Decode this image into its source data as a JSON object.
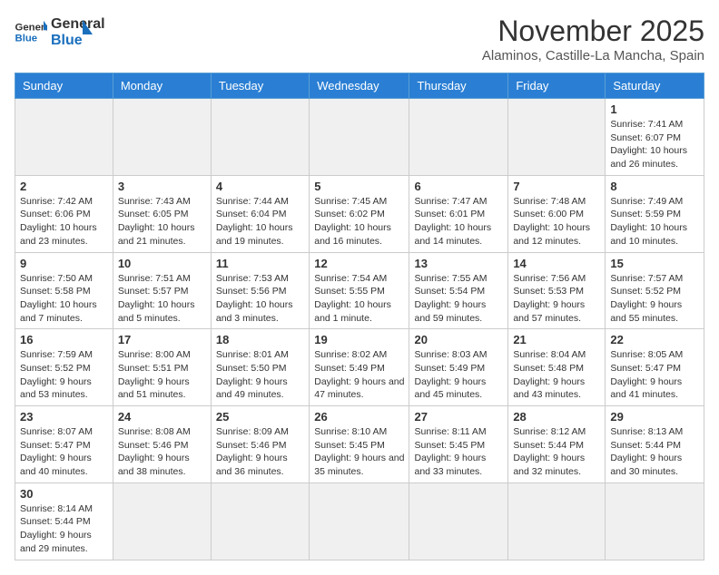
{
  "header": {
    "logo_general": "General",
    "logo_blue": "Blue",
    "month_title": "November 2025",
    "location": "Alaminos, Castille-La Mancha, Spain"
  },
  "weekdays": [
    "Sunday",
    "Monday",
    "Tuesday",
    "Wednesday",
    "Thursday",
    "Friday",
    "Saturday"
  ],
  "weeks": [
    [
      {
        "day": "",
        "info": ""
      },
      {
        "day": "",
        "info": ""
      },
      {
        "day": "",
        "info": ""
      },
      {
        "day": "",
        "info": ""
      },
      {
        "day": "",
        "info": ""
      },
      {
        "day": "",
        "info": ""
      },
      {
        "day": "1",
        "info": "Sunrise: 7:41 AM\nSunset: 6:07 PM\nDaylight: 10 hours and 26 minutes."
      }
    ],
    [
      {
        "day": "2",
        "info": "Sunrise: 7:42 AM\nSunset: 6:06 PM\nDaylight: 10 hours and 23 minutes."
      },
      {
        "day": "3",
        "info": "Sunrise: 7:43 AM\nSunset: 6:05 PM\nDaylight: 10 hours and 21 minutes."
      },
      {
        "day": "4",
        "info": "Sunrise: 7:44 AM\nSunset: 6:04 PM\nDaylight: 10 hours and 19 minutes."
      },
      {
        "day": "5",
        "info": "Sunrise: 7:45 AM\nSunset: 6:02 PM\nDaylight: 10 hours and 16 minutes."
      },
      {
        "day": "6",
        "info": "Sunrise: 7:47 AM\nSunset: 6:01 PM\nDaylight: 10 hours and 14 minutes."
      },
      {
        "day": "7",
        "info": "Sunrise: 7:48 AM\nSunset: 6:00 PM\nDaylight: 10 hours and 12 minutes."
      },
      {
        "day": "8",
        "info": "Sunrise: 7:49 AM\nSunset: 5:59 PM\nDaylight: 10 hours and 10 minutes."
      }
    ],
    [
      {
        "day": "9",
        "info": "Sunrise: 7:50 AM\nSunset: 5:58 PM\nDaylight: 10 hours and 7 minutes."
      },
      {
        "day": "10",
        "info": "Sunrise: 7:51 AM\nSunset: 5:57 PM\nDaylight: 10 hours and 5 minutes."
      },
      {
        "day": "11",
        "info": "Sunrise: 7:53 AM\nSunset: 5:56 PM\nDaylight: 10 hours and 3 minutes."
      },
      {
        "day": "12",
        "info": "Sunrise: 7:54 AM\nSunset: 5:55 PM\nDaylight: 10 hours and 1 minute."
      },
      {
        "day": "13",
        "info": "Sunrise: 7:55 AM\nSunset: 5:54 PM\nDaylight: 9 hours and 59 minutes."
      },
      {
        "day": "14",
        "info": "Sunrise: 7:56 AM\nSunset: 5:53 PM\nDaylight: 9 hours and 57 minutes."
      },
      {
        "day": "15",
        "info": "Sunrise: 7:57 AM\nSunset: 5:52 PM\nDaylight: 9 hours and 55 minutes."
      }
    ],
    [
      {
        "day": "16",
        "info": "Sunrise: 7:59 AM\nSunset: 5:52 PM\nDaylight: 9 hours and 53 minutes."
      },
      {
        "day": "17",
        "info": "Sunrise: 8:00 AM\nSunset: 5:51 PM\nDaylight: 9 hours and 51 minutes."
      },
      {
        "day": "18",
        "info": "Sunrise: 8:01 AM\nSunset: 5:50 PM\nDaylight: 9 hours and 49 minutes."
      },
      {
        "day": "19",
        "info": "Sunrise: 8:02 AM\nSunset: 5:49 PM\nDaylight: 9 hours and 47 minutes."
      },
      {
        "day": "20",
        "info": "Sunrise: 8:03 AM\nSunset: 5:49 PM\nDaylight: 9 hours and 45 minutes."
      },
      {
        "day": "21",
        "info": "Sunrise: 8:04 AM\nSunset: 5:48 PM\nDaylight: 9 hours and 43 minutes."
      },
      {
        "day": "22",
        "info": "Sunrise: 8:05 AM\nSunset: 5:47 PM\nDaylight: 9 hours and 41 minutes."
      }
    ],
    [
      {
        "day": "23",
        "info": "Sunrise: 8:07 AM\nSunset: 5:47 PM\nDaylight: 9 hours and 40 minutes."
      },
      {
        "day": "24",
        "info": "Sunrise: 8:08 AM\nSunset: 5:46 PM\nDaylight: 9 hours and 38 minutes."
      },
      {
        "day": "25",
        "info": "Sunrise: 8:09 AM\nSunset: 5:46 PM\nDaylight: 9 hours and 36 minutes."
      },
      {
        "day": "26",
        "info": "Sunrise: 8:10 AM\nSunset: 5:45 PM\nDaylight: 9 hours and 35 minutes."
      },
      {
        "day": "27",
        "info": "Sunrise: 8:11 AM\nSunset: 5:45 PM\nDaylight: 9 hours and 33 minutes."
      },
      {
        "day": "28",
        "info": "Sunrise: 8:12 AM\nSunset: 5:44 PM\nDaylight: 9 hours and 32 minutes."
      },
      {
        "day": "29",
        "info": "Sunrise: 8:13 AM\nSunset: 5:44 PM\nDaylight: 9 hours and 30 minutes."
      }
    ],
    [
      {
        "day": "30",
        "info": "Sunrise: 8:14 AM\nSunset: 5:44 PM\nDaylight: 9 hours and 29 minutes."
      },
      {
        "day": "",
        "info": ""
      },
      {
        "day": "",
        "info": ""
      },
      {
        "day": "",
        "info": ""
      },
      {
        "day": "",
        "info": ""
      },
      {
        "day": "",
        "info": ""
      },
      {
        "day": "",
        "info": ""
      }
    ]
  ]
}
